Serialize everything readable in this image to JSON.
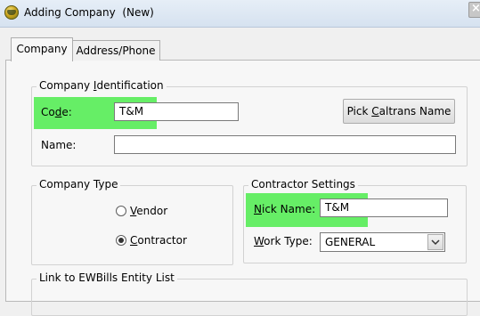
{
  "window": {
    "title": "Adding Company  (New)"
  },
  "tabs": [
    {
      "label": "Company"
    },
    {
      "label": "Address/Phone"
    }
  ],
  "company_identification": {
    "group_title_pre": "Company ",
    "group_title_ul": "I",
    "group_title_post": "dentification",
    "code_label_pre": "Co",
    "code_label_ul": "d",
    "code_label_post": "e:",
    "code_value": "T&M",
    "pick_button_pre": "Pick ",
    "pick_button_ul": "C",
    "pick_button_post": "altrans Name",
    "name_label": "Name:",
    "name_value": ""
  },
  "company_type": {
    "group_title": "Company Type",
    "vendor_ul": "V",
    "vendor_rest": "endor",
    "contractor_ul": "C",
    "contractor_rest": "ontractor",
    "selected": "Contractor"
  },
  "contractor_settings": {
    "group_title": "Contractor Settings",
    "nick_label_ul": "N",
    "nick_label_rest": "ick Name:",
    "nick_value": "T&M",
    "work_type_label_ul": "W",
    "work_type_label_rest": "ork Type:",
    "work_type_value": "GENERAL"
  },
  "ewbills": {
    "group_title": "Link to EWBills Entity List"
  },
  "colors": {
    "highlight": "#66ee66"
  },
  "icons": [
    "app-icon",
    "close-icon",
    "chevron-down-icon"
  ]
}
